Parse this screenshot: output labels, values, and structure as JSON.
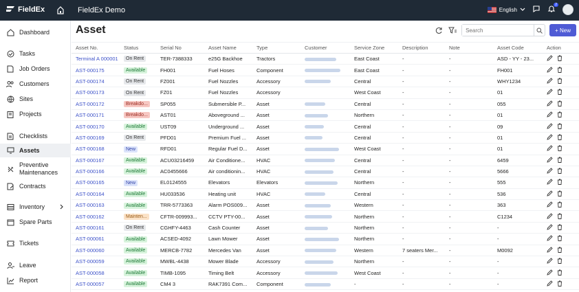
{
  "topbar": {
    "brand": "FieldEx",
    "app_title": "FieldEx Demo",
    "language": "English",
    "notification_count": "2"
  },
  "sidebar": {
    "items": [
      {
        "label": "Dashboard",
        "icon": "home-icon"
      },
      {
        "label": "Tasks",
        "icon": "check-circle-icon"
      },
      {
        "label": "Job Orders",
        "icon": "document-icon"
      },
      {
        "label": "Customers",
        "icon": "users-icon"
      },
      {
        "label": "Sites",
        "icon": "globe-icon"
      },
      {
        "label": "Projects",
        "icon": "clipboard-icon"
      },
      {
        "label": "Checklists",
        "icon": "checklist-icon"
      },
      {
        "label": "Assets",
        "icon": "monitor-icon"
      },
      {
        "label": "Preventive Maintenances",
        "icon": "tools-icon"
      },
      {
        "label": "Contracts",
        "icon": "contract-icon"
      },
      {
        "label": "Inventory",
        "icon": "inventory-icon"
      },
      {
        "label": "Spare Parts",
        "icon": "box-icon"
      },
      {
        "label": "Tickets",
        "icon": "ticket-icon"
      },
      {
        "label": "Leave",
        "icon": "person-icon"
      },
      {
        "label": "Report",
        "icon": "chart-icon"
      }
    ]
  },
  "main": {
    "title": "Asset",
    "search_placeholder": "Search",
    "new_label": "+ New",
    "columns": [
      "Asset No.",
      "Status",
      "Serial No",
      "Asset Name",
      "Type",
      "Customer",
      "Service Zone",
      "Description",
      "Note",
      "Asset Code",
      "Action"
    ],
    "rows": [
      {
        "asset_no": "Terminal A 000001",
        "status": "On Rent",
        "status_kind": "rent",
        "serial": "TER-7388333",
        "name": "e25G Backhoe",
        "type": "Tractors",
        "zone": "East Coast",
        "desc": "-",
        "note": "-",
        "code": "ASD - YY - 23..."
      },
      {
        "asset_no": "AST-000175",
        "status": "Available",
        "status_kind": "avail",
        "serial": "FH001",
        "name": "Fuel Hoses",
        "type": "Component",
        "zone": "East Coast",
        "desc": "-",
        "note": "-",
        "code": "FH001"
      },
      {
        "asset_no": "AST-000174",
        "status": "On Rent",
        "status_kind": "rent",
        "serial": "FZ001",
        "name": "Fuel Nozzles",
        "type": "Accessory",
        "zone": "Central",
        "desc": "-",
        "note": "-",
        "code": "WHY1234"
      },
      {
        "asset_no": "AST-000173",
        "status": "On Rent",
        "status_kind": "rent",
        "serial": "FZ01",
        "name": "Fuel Nozzles",
        "type": "Accessory",
        "zone": "West Coast",
        "desc": "-",
        "note": "-",
        "code": "01"
      },
      {
        "asset_no": "AST-000172",
        "status": "Breakdo...",
        "status_kind": "break",
        "serial": "SP055",
        "name": "Submersible P...",
        "type": "Asset",
        "zone": "Central",
        "desc": "-",
        "note": "-",
        "code": "055"
      },
      {
        "asset_no": "AST-000171",
        "status": "Breakdo...",
        "status_kind": "break",
        "serial": "AST01",
        "name": "Aboveground ...",
        "type": "Asset",
        "zone": "Northern",
        "desc": "-",
        "note": "-",
        "code": "01"
      },
      {
        "asset_no": "AST-000170",
        "status": "Available",
        "status_kind": "avail",
        "serial": "UST09",
        "name": "Underground ...",
        "type": "Asset",
        "zone": "Central",
        "desc": "-",
        "note": "-",
        "code": "09"
      },
      {
        "asset_no": "AST-000169",
        "status": "On Rent",
        "status_kind": "rent",
        "serial": "PFD01",
        "name": "Premium Fuel ...",
        "type": "Asset",
        "zone": "Central",
        "desc": "-",
        "note": "-",
        "code": "01"
      },
      {
        "asset_no": "AST-000168",
        "status": "New",
        "status_kind": "new",
        "serial": "RFD01",
        "name": "Regular Fuel D...",
        "type": "Asset",
        "zone": "West Coast",
        "desc": "-",
        "note": "-",
        "code": "01"
      },
      {
        "asset_no": "AST-000167",
        "status": "Available",
        "status_kind": "avail",
        "serial": "ACU03216459",
        "name": "Air Conditione...",
        "type": "HVAC",
        "zone": "Central",
        "desc": "-",
        "note": "-",
        "code": "6459"
      },
      {
        "asset_no": "AST-000166",
        "status": "Available",
        "status_kind": "avail",
        "serial": "AC0455666",
        "name": "Air conditionin...",
        "type": "HVAC",
        "zone": "Central",
        "desc": "-",
        "note": "-",
        "code": "5666"
      },
      {
        "asset_no": "AST-000165",
        "status": "New",
        "status_kind": "new",
        "serial": "EL0124555",
        "name": "Elevators",
        "type": "Elevators",
        "zone": "Northern",
        "desc": "-",
        "note": "-",
        "code": "555"
      },
      {
        "asset_no": "AST-000164",
        "status": "Available",
        "status_kind": "avail",
        "serial": "HU033536",
        "name": "Heating unit",
        "type": "HVAC",
        "zone": "Central",
        "desc": "-",
        "note": "-",
        "code": "536"
      },
      {
        "asset_no": "AST-000163",
        "status": "Available",
        "status_kind": "avail",
        "serial": "TRR-5773363",
        "name": "Alarm POS009...",
        "type": "Asset",
        "zone": "Western",
        "desc": "-",
        "note": "-",
        "code": "363"
      },
      {
        "asset_no": "AST-000162",
        "status": "Mainten...",
        "status_kind": "maint",
        "serial": "CFTR-009993...",
        "name": "CCTV PTY-00...",
        "type": "Asset",
        "zone": "Northern",
        "desc": "-",
        "note": "-",
        "code": "C1234"
      },
      {
        "asset_no": "AST-000161",
        "status": "On Rent",
        "status_kind": "rent",
        "serial": "CGHFY-4463",
        "name": "Cash Counter",
        "type": "Asset",
        "zone": "Northern",
        "desc": "-",
        "note": "-",
        "code": "-"
      },
      {
        "asset_no": "AST-000061",
        "status": "Available",
        "status_kind": "avail",
        "serial": "ACSED-4092",
        "name": "Lawn Mower",
        "type": "Asset",
        "zone": "Northern",
        "desc": "-",
        "note": "-",
        "code": "-"
      },
      {
        "asset_no": "AST-000060",
        "status": "Available",
        "status_kind": "avail",
        "serial": "MERCB-7782",
        "name": "Mercedes Van",
        "type": "Asset",
        "zone": "Western",
        "desc": "7 seaters Mer...",
        "note": "-",
        "code": "M0092"
      },
      {
        "asset_no": "AST-000059",
        "status": "Available",
        "status_kind": "avail",
        "serial": "MWBL-4438",
        "name": "Mower Blade",
        "type": "Accessory",
        "zone": "Northern",
        "desc": "-",
        "note": "-",
        "code": "-"
      },
      {
        "asset_no": "AST-000058",
        "status": "Available",
        "status_kind": "avail",
        "serial": "TIMB-1095",
        "name": "Timing Belt",
        "type": "Accessory",
        "zone": "West Coast",
        "desc": "-",
        "note": "-",
        "code": "-"
      },
      {
        "asset_no": "AST-000057",
        "status": "Available",
        "status_kind": "avail",
        "serial": "CM4 3",
        "name": "RAK7391 Com...",
        "type": "Component",
        "zone": "-",
        "desc": "-",
        "note": "-",
        "code": "-"
      }
    ]
  },
  "colors": {
    "topbar": "#1f2a36",
    "accent": "#4f5bd5",
    "link": "#3d52c9"
  }
}
